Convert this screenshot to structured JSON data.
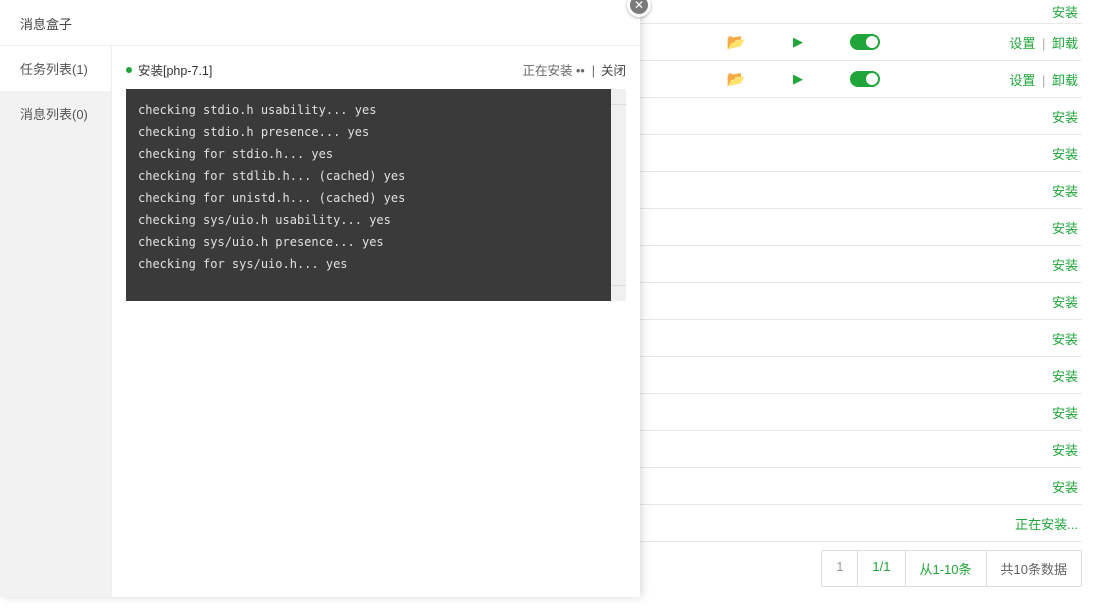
{
  "modal": {
    "title": "消息盒子",
    "sidebar": {
      "tab_task": "任务列表(1)",
      "tab_msg": "消息列表(0)"
    },
    "task": {
      "name": "安装[php-7.1]",
      "status_prefix": "正在安装",
      "close": "关闭"
    },
    "log_lines": [
      "checking stdio.h usability... yes",
      "checking stdio.h presence... yes",
      "checking for stdio.h... yes",
      "checking for stdlib.h... (cached) yes",
      "checking for unistd.h... (cached) yes",
      "checking sys/uio.h usability... yes",
      "checking sys/uio.h presence... yes",
      "checking for sys/uio.h... yes"
    ]
  },
  "table": {
    "actions": {
      "install": "安装",
      "settings": "设置",
      "uninstall": "卸载",
      "installing": "正在安装..."
    },
    "rows": [
      {
        "type": "head_install"
      },
      {
        "type": "full"
      },
      {
        "type": "full"
      },
      {
        "type": "install"
      },
      {
        "type": "install"
      },
      {
        "type": "install"
      },
      {
        "type": "install"
      },
      {
        "type": "install"
      },
      {
        "type": "install"
      },
      {
        "type": "install"
      },
      {
        "type": "install"
      },
      {
        "type": "install"
      },
      {
        "type": "install"
      },
      {
        "type": "install"
      },
      {
        "type": "installing"
      }
    ]
  },
  "pagination": {
    "page": "1",
    "pages": "1/1",
    "range": "从1-10条",
    "total": "共10条数据"
  }
}
